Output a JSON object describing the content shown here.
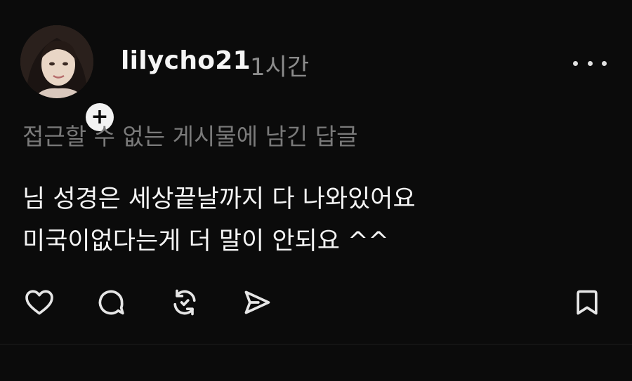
{
  "post": {
    "username": "lilycho21",
    "timestamp": "1시간",
    "reply_context": "접근할 수 없는 게시물에 남긴 답글",
    "body_lines": [
      "님 성경은 세상끝날까지 다 나와있어요",
      "미국이없다는게 더 말이 안되요 ^^"
    ],
    "follow_symbol": "+"
  },
  "icons": {
    "avatar": "profile-photo",
    "follow": "plus-icon",
    "more": "more-dots-icon",
    "like": "heart-icon",
    "comment": "comment-bubble-icon",
    "repost": "repost-icon",
    "share": "send-icon",
    "save": "bookmark-icon"
  },
  "colors": {
    "background": "#0b0b0b",
    "text_primary": "#f4f4f4",
    "text_secondary": "#8c8c8c",
    "icon": "#e6e6e6"
  }
}
